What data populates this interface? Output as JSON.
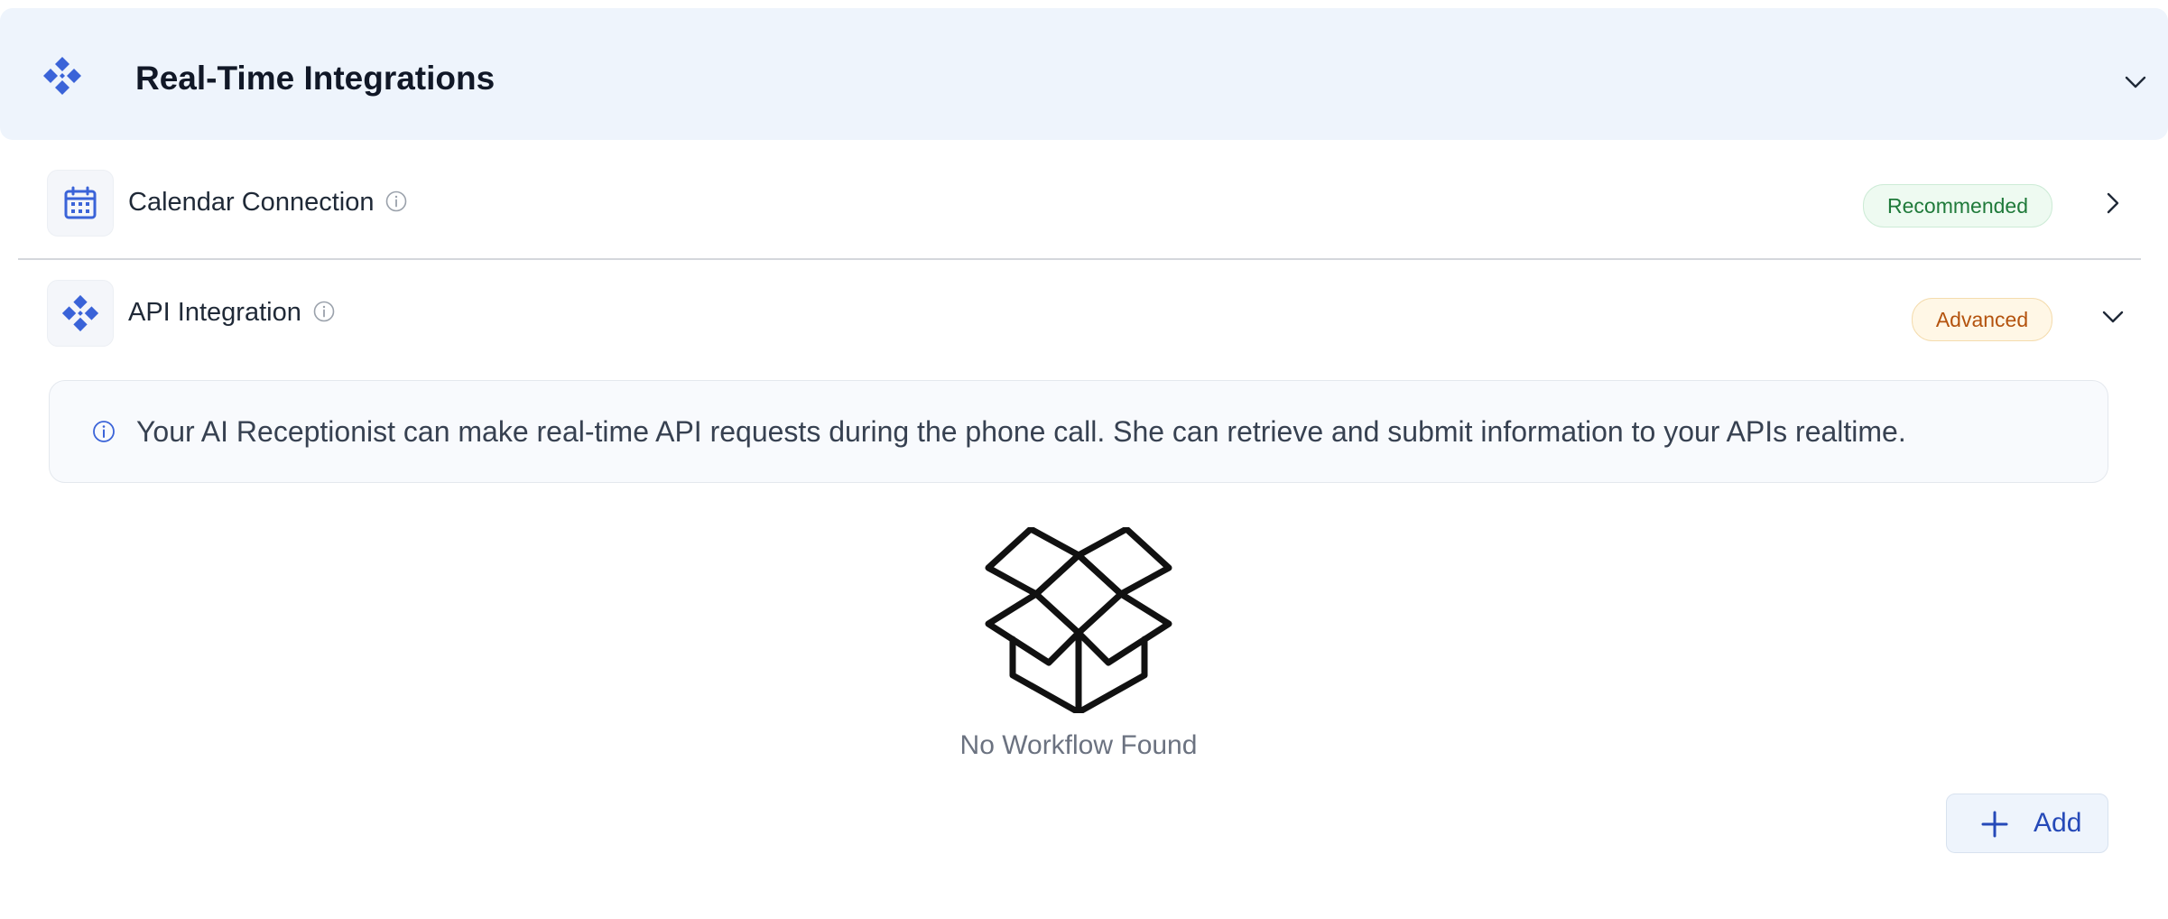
{
  "section": {
    "title": "Real-Time Integrations",
    "icon": "diamond-cluster-icon",
    "expanded": true
  },
  "integrations": [
    {
      "label": "Calendar Connection",
      "icon": "calendar-icon",
      "badge": "Recommended",
      "badge_color": "#1f7a3a",
      "expanded": false
    },
    {
      "label": "API Integration",
      "icon": "diamond-cluster-icon",
      "badge": "Advanced",
      "badge_color": "#b4530e",
      "expanded": true
    }
  ],
  "api_panel": {
    "info_text": "Your AI Receptionist can make real-time API requests during the phone call. She can retrieve and submit information to your APIs realtime.",
    "empty_text": "No Workflow Found",
    "empty_icon": "open-box-icon",
    "add_label": "Add"
  },
  "colors": {
    "accent": "#3a63d8",
    "header_bg": "#eef4fc"
  }
}
